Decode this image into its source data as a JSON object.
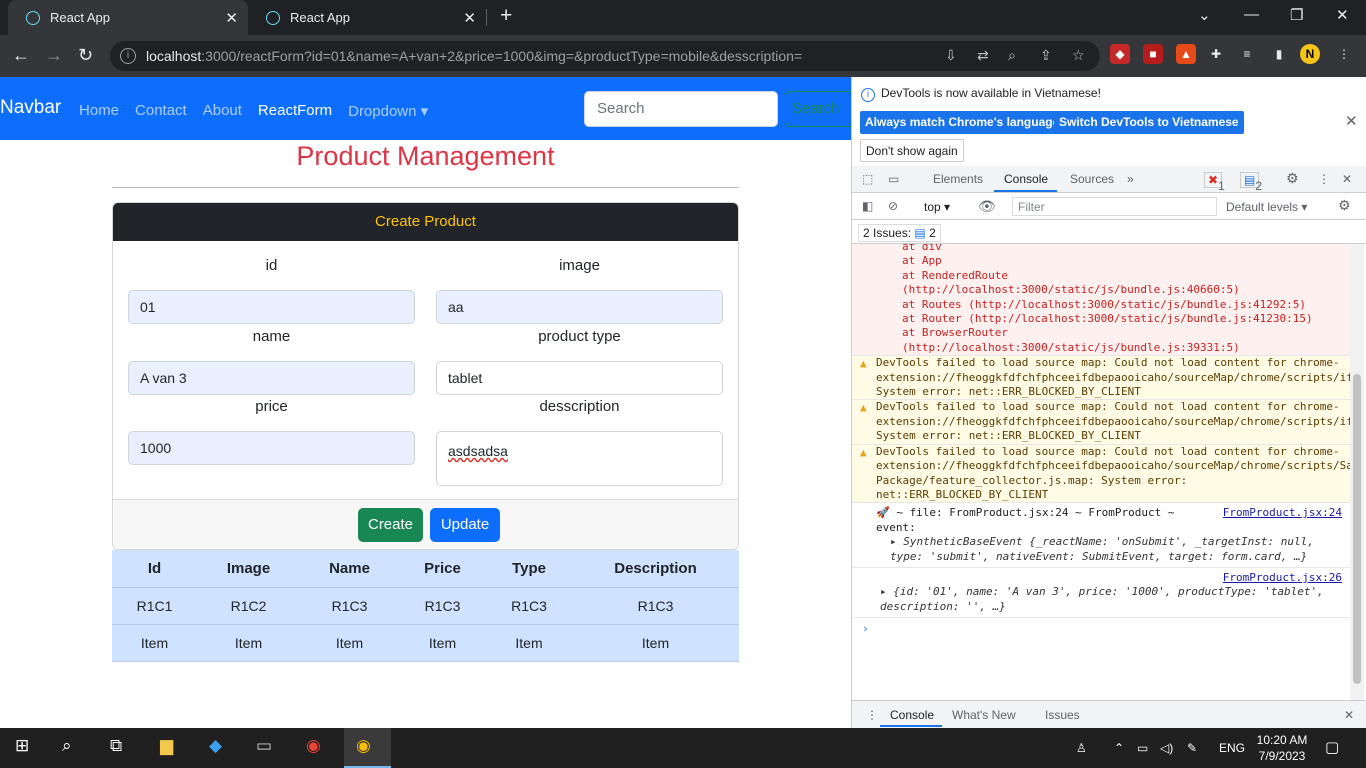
{
  "browser": {
    "tabs": [
      {
        "title": "React App"
      },
      {
        "title": "React App"
      }
    ],
    "url_host": "localhost",
    "url_rest": ":3000/reactForm?id=01&name=A+van+2&price=1000&img=&productType=mobile&desscription="
  },
  "navbar": {
    "brand": "Navbar",
    "links": [
      "Home",
      "Contact",
      "About",
      "ReactForm",
      "Dropdown ▾"
    ],
    "search_placeholder": "Search",
    "search_button": "Search"
  },
  "page": {
    "title": "Product Management",
    "card_header": "Create Product",
    "fields": {
      "id": {
        "label": "id",
        "value": "01"
      },
      "image": {
        "label": "image",
        "value": "aa"
      },
      "name": {
        "label": "name",
        "value": "A van 3"
      },
      "product_type": {
        "label": "product type",
        "value": "tablet"
      },
      "price": {
        "label": "price",
        "value": "1000"
      },
      "description": {
        "label": "desscription",
        "value": "asdsadsa"
      }
    },
    "buttons": {
      "create": "Create",
      "update": "Update"
    },
    "table": {
      "headers": [
        "Id",
        "Image",
        "Name",
        "Price",
        "Type",
        "Description"
      ],
      "rows": [
        [
          "R1C1",
          "R1C2",
          "R1C3",
          "R1C3",
          "R1C3",
          "R1C3"
        ],
        [
          "Item",
          "Item",
          "Item",
          "Item",
          "Item",
          "Item"
        ]
      ]
    }
  },
  "devtools": {
    "banner": "DevTools is now available in Vietnamese!",
    "btn_match": "Always match Chrome's language",
    "btn_switch": "Switch DevTools to Vietnamese",
    "btn_dont": "Don't show again",
    "tabs": [
      "Elements",
      "Console",
      "Sources"
    ],
    "error_count": "1",
    "message_count": "2",
    "context": "top",
    "filter_placeholder": "Filter",
    "levels": "Default levels ▾",
    "issues": "2 Issues:",
    "issues_count": "2",
    "stack": [
      "at div",
      "at App",
      "at RenderedRoute (http://localhost:3000/static/js/bundle.js:40660:5)",
      "at Routes (http://localhost:3000/static/js/bundle.js:41292:5)",
      "at Router (http://localhost:3000/static/js/bundle.js:41230:15)",
      "at BrowserRouter (http://localhost:3000/static/js/bundle.js:39331:5)"
    ],
    "warnings": [
      "DevTools failed to load source map: Could not load content for chrome-extension://fheoggkfdfchfphceeifdbepaooicaho/sourceMap/chrome/scripts/iframe_form_check.js.map: System error: net::ERR_BLOCKED_BY_CLIENT",
      "DevTools failed to load source map: Could not load content for chrome-extension://fheoggkfdfchfphceeifdbepaooicaho/sourceMap/chrome/scripts/iframe_form_detection.js.map: System error: net::ERR_BLOCKED_BY_CLIENT",
      "DevTools failed to load source map: Could not load content for chrome-extension://fheoggkfdfchfphceeifdbepaooicaho/sourceMap/chrome/scripts/Sailer-Package/feature_collector.js.map: System error: net::ERR_BLOCKED_BY_CLIENT"
    ],
    "log1_text": "🚀 ~ file: FromProduct.jsx:24 ~ FromProduct ~ event:",
    "log1_src": "FromProduct.jsx:24",
    "log1_obj": "SyntheticBaseEvent {_reactName: 'onSubmit', _targetInst: null, type: 'submit', nativeEvent: SubmitEvent, target: form.card, …}",
    "log2_src": "FromProduct.jsx:26",
    "log2_obj": "{id: '01', name: 'A van 3', price: '1000', productType: 'tablet', description: '', …}",
    "drawer_tabs": [
      "Console",
      "What's New",
      "Issues"
    ]
  },
  "taskbar": {
    "lang": "ENG",
    "time": "10:20 AM",
    "date": "7/9/2023"
  },
  "colors": {
    "primary": "#0d6efd",
    "success": "#198754",
    "danger": "#dc3545",
    "warning": "#ffc107"
  }
}
